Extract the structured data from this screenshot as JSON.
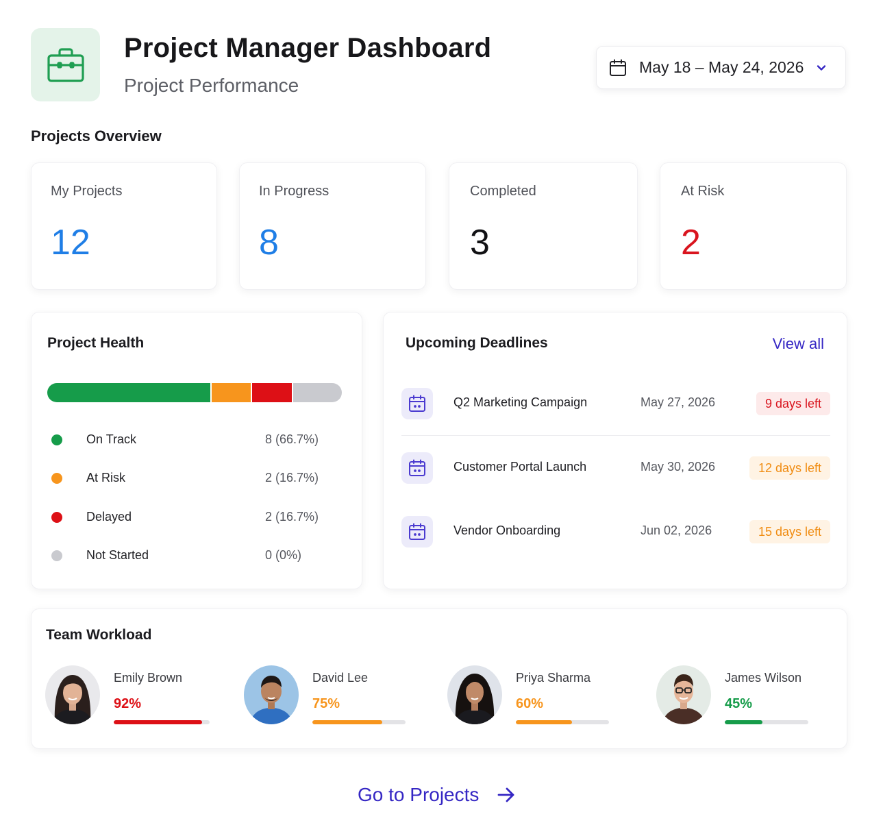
{
  "header": {
    "title": "Project Manager Dashboard",
    "subtitle": "Project Performance",
    "logo_icon": "briefcase-icon",
    "date_range": "May 18 – May 24, 2026",
    "date_icon": "calendar-icon",
    "dropdown_icon": "chevron-down-icon"
  },
  "overview": {
    "title": "Projects Overview",
    "stats": [
      {
        "label": "My Projects",
        "value": "12",
        "color": "#1f7ee6"
      },
      {
        "label": "In Progress",
        "value": "8",
        "color": "#1f7ee6"
      },
      {
        "label": "Completed",
        "value": "3",
        "color": "#111114"
      },
      {
        "label": "At Risk",
        "value": "2",
        "color": "#d9141e"
      }
    ]
  },
  "health": {
    "title": "Project Health",
    "items": [
      {
        "label": "On Track",
        "value": "8 (66.7%)",
        "count": 8,
        "color": "#169c4a"
      },
      {
        "label": "At Risk",
        "value": "2 (16.7%)",
        "count": 2,
        "color": "#f7951d"
      },
      {
        "label": "Delayed",
        "value": "2 (16.7%)",
        "count": 2,
        "color": "#dd1016"
      },
      {
        "label": "Not Started",
        "value": "0 (0%)",
        "count": 0,
        "color": "#c9cacf"
      }
    ]
  },
  "deadlines": {
    "title": "Upcoming Deadlines",
    "view_all": "View all",
    "row_icon": "calendar-icon",
    "items": [
      {
        "name": "Q2 Marketing Campaign",
        "date": "May 27, 2026",
        "badge": "9 days left",
        "badge_color": "#d9141e",
        "badge_bg": "#fdeaea"
      },
      {
        "name": "Customer Portal Launch",
        "date": "May 30, 2026",
        "badge": "12 days left",
        "badge_color": "#f08c12",
        "badge_bg": "#fff3e4"
      },
      {
        "name": "Vendor Onboarding",
        "date": "Jun 02, 2026",
        "badge": "15 days left",
        "badge_color": "#f08c12",
        "badge_bg": "#fff3e4"
      }
    ]
  },
  "workload": {
    "title": "Team Workload",
    "members": [
      {
        "name": "Emily Brown",
        "percent_label": "92%",
        "percent": 0.92,
        "color": "#dd1016"
      },
      {
        "name": "David Lee",
        "percent_label": "75%",
        "percent": 0.75,
        "color": "#f7951d"
      },
      {
        "name": "Priya Sharma",
        "percent_label": "60%",
        "percent": 0.6,
        "color": "#f7951d"
      },
      {
        "name": "James Wilson",
        "percent_label": "45%",
        "percent": 0.45,
        "color": "#169c4a"
      }
    ]
  },
  "footer": {
    "cta_label": "Go to Projects",
    "cta_icon": "arrow-right-icon"
  }
}
